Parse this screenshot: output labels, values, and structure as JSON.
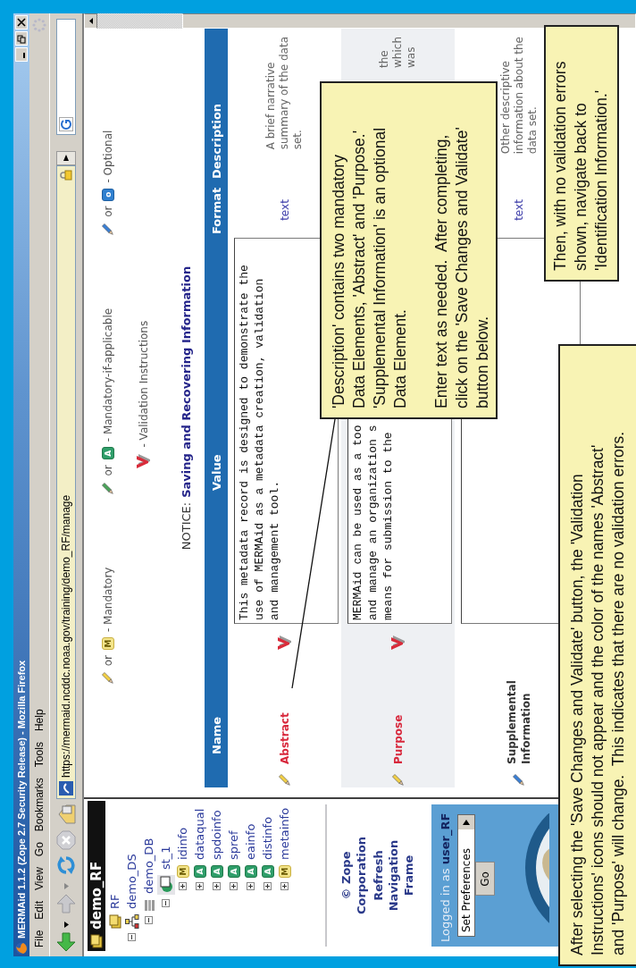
{
  "window": {
    "title": "MERMAid 1.1.2 (Zope 2.7 Security Release) - Mozilla Firefox",
    "menu": [
      "File",
      "Edit",
      "View",
      "Go",
      "Bookmarks",
      "Tools",
      "Help"
    ]
  },
  "address_bar": {
    "url": "https://mermaid.ncddc.noaa.gov/training/demo_RF/manage"
  },
  "navigation": {
    "header": "demo_RF",
    "tree": [
      {
        "label": "RF",
        "kind": "root"
      },
      {
        "label": "demo_DS",
        "kind": "dataset",
        "expanded": true,
        "children": [
          {
            "label": "demo_DB",
            "kind": "database",
            "expanded": true,
            "children": [
              {
                "label": "st_1",
                "kind": "standard",
                "expanded": true,
                "children": [
                  {
                    "label": "idinfo",
                    "kind": "mandatory",
                    "badge": "M",
                    "expanded": false
                  },
                  {
                    "label": "dataqual",
                    "kind": "conditional",
                    "badge": "A",
                    "expanded": false
                  },
                  {
                    "label": "spdoinfo",
                    "kind": "conditional",
                    "badge": "A",
                    "expanded": false
                  },
                  {
                    "label": "spref",
                    "kind": "conditional",
                    "badge": "A",
                    "expanded": false
                  },
                  {
                    "label": "eainfo",
                    "kind": "conditional",
                    "badge": "A",
                    "expanded": false
                  },
                  {
                    "label": "distinfo",
                    "kind": "conditional",
                    "badge": "A",
                    "expanded": false
                  },
                  {
                    "label": "metainfo",
                    "kind": "mandatory",
                    "badge": "M",
                    "expanded": false
                  }
                ]
              }
            ]
          }
        ]
      }
    ],
    "links": [
      "© Zope Corporation",
      "Refresh Navigation Frame"
    ],
    "login": "Logged in as **user_RF**",
    "preferences": "Set Preferences",
    "go": "Go"
  },
  "legend": [
    {
      "kind": "mandatory",
      "joiner": "or",
      "badge": "M",
      "label": "- Mandatory"
    },
    {
      "kind": "conditional",
      "joiner": "or",
      "badge": "A",
      "label": "- Mandatory-if-applicable"
    },
    {
      "kind": "optional",
      "joiner": "or",
      "badge": "o",
      "label": "- Optional"
    }
  ],
  "validation_legend": "- Validation Instructions",
  "notice": {
    "prefix": "NOTICE:",
    "title": "Saving and Recovering Information"
  },
  "table": {
    "columns": [
      "Name",
      "Value",
      "Format",
      "Description"
    ],
    "rows": [
      {
        "name": "Abstract",
        "kind": "mandatory",
        "invalid": true,
        "value": "This metadata record is designed to demonstrate the\nuse of MERMAid as a metadata creation, validation\nand management tool.",
        "format": "text",
        "description": "A brief narrative\nsummary of the data\nset."
      },
      {
        "name": "Purpose",
        "kind": "mandatory",
        "invalid": true,
        "value": "MERMAid can be used as a too\nand manage an organization s\nmeans for submission to the",
        "description": "the\nwhich\nwas"
      },
      {
        "name": "Supplemental Information",
        "kind": "optional",
        "invalid": false,
        "format": "text",
        "description": "Other descriptive\ninformation about the\ndata set."
      }
    ]
  },
  "callouts": [
    {
      "paragraphs": [
        "'Description' contains two mandatory\nData Elements, 'Abstract' and 'Purpose.'\n'Supplemental Information' is an optional\nData Element.",
        "Enter text as needed.  After completing,\nclick on the 'Save Changes and Validate'\nbutton below."
      ]
    },
    {
      "paragraphs": [
        "Then, with no validation errors\nshown, navigate back to\n'Identification Information.'"
      ]
    },
    {
      "paragraphs": [
        "After selecting the 'Save Changes and Validate' button, the 'Validation\nInstructions' icons should not appear and the color of the names 'Abstract'\nand 'Purpose' will change.  This indicates that there are no validation errors."
      ]
    }
  ]
}
